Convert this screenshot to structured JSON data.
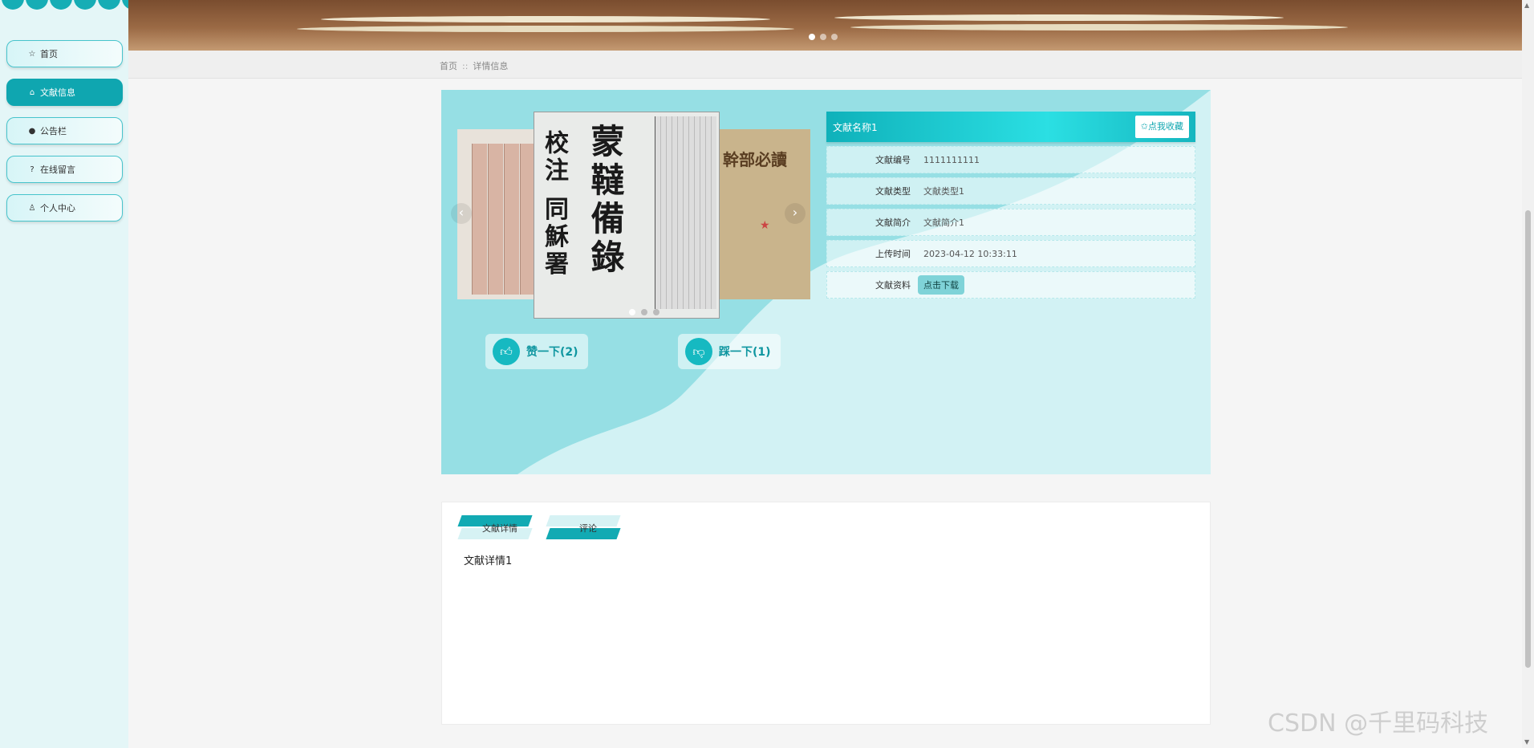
{
  "sidebar": {
    "items": [
      {
        "label": "首页",
        "icon": "star-icon"
      },
      {
        "label": "文献信息",
        "icon": "bag-icon"
      },
      {
        "label": "公告栏",
        "icon": "info-icon"
      },
      {
        "label": "在线留言",
        "icon": "question-icon"
      },
      {
        "label": "个人中心",
        "icon": "user-icon"
      }
    ]
  },
  "breadcrumb": {
    "home": "首页",
    "separator": "::",
    "current": "详情信息"
  },
  "detail": {
    "title": "文献名称1",
    "favorite_label": "✩点我收藏",
    "fields": [
      {
        "label": "文献编号",
        "value": "1111111111"
      },
      {
        "label": "文献类型",
        "value": "文献类型1"
      },
      {
        "label": "文献简介",
        "value": "文献简介1"
      },
      {
        "label": "上传时间",
        "value": "2023-04-12 10:33:11"
      }
    ],
    "file_label": "文献资料",
    "download_label": "点击下载",
    "like_label": "赞一下(2)",
    "dislike_label": "踩一下(1)",
    "image_text_center": [
      "蒙韃備錄",
      "校注 同穌署"
    ],
    "image_text_right": "幹部必讀"
  },
  "tabs": [
    {
      "label": "文献详情"
    },
    {
      "label": "评论"
    }
  ],
  "tab_content": "文献详情1",
  "watermark": "CSDN @千里码科技",
  "colors": {
    "accent": "#0fa6b0",
    "card_bg": "#96dfe4",
    "sidebar_bg": "#e4f6f7"
  }
}
